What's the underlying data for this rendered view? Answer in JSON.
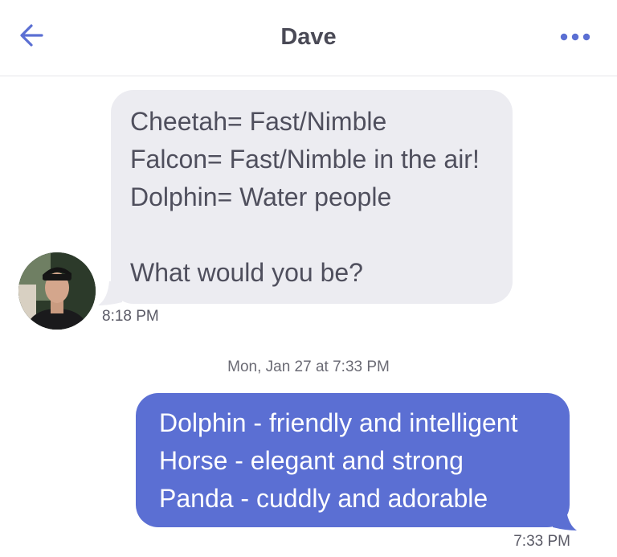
{
  "header": {
    "title": "Dave",
    "back_icon": "arrow-left-icon",
    "more_icon": "more-horizontal-icon",
    "accent_color": "#5b6fd3"
  },
  "messages": [
    {
      "direction": "incoming",
      "lines": [
        "Cheetah= Fast/Nimble",
        "Falcon= Fast/Nimble in the air!",
        "Dolphin= Water people",
        "",
        "What would you be?"
      ],
      "time": "8:18 PM"
    },
    {
      "direction": "outgoing",
      "lines": [
        "Dolphin - friendly and intelligent",
        "Horse - elegant and strong",
        "Panda - cuddly and adorable"
      ],
      "time": "7:33 PM"
    }
  ],
  "date_divider": "Mon, Jan 27 at 7:33 PM",
  "colors": {
    "incoming_bubble": "#ececf1",
    "outgoing_bubble": "#5b6fd3"
  }
}
